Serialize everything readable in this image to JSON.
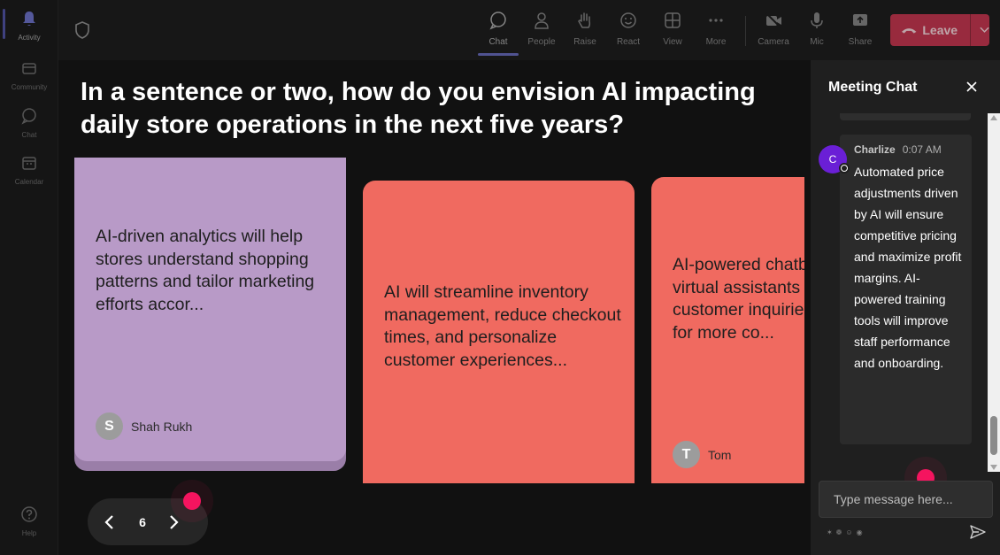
{
  "rail": [
    {
      "label": "Activity",
      "icon": "bell-icon"
    },
    {
      "label": "Community",
      "icon": "community-icon"
    },
    {
      "label": "Chat",
      "icon": "chat-icon"
    },
    {
      "label": "Calendar",
      "icon": "calendar-icon"
    },
    {
      "label": "Help",
      "icon": "help-icon"
    }
  ],
  "toolbar": {
    "chat": "Chat",
    "people": "People",
    "raise": "Raise",
    "react": "React",
    "view": "View",
    "more": "More",
    "camera": "Camera",
    "mic": "Mic",
    "share": "Share",
    "leave": "Leave"
  },
  "question": "In a sentence or two, how do you envision AI impacting daily store operations in the next five years?",
  "cards": [
    {
      "text": "AI-driven analytics will help stores understand shopping patterns and tailor marketing efforts accor...",
      "author": "Shah Rukh",
      "initial": "S",
      "color": "#b89ac7"
    },
    {
      "text": "AI will streamline inventory management, reduce checkout times, and personalize customer experiences...",
      "author": "",
      "initial": "",
      "color": "#f06a60"
    },
    {
      "text": "AI-powered chatbots and virtual assistants customer inquiries staff for more co...",
      "author": "Tom",
      "initial": "T",
      "color": "#f06a60"
    }
  ],
  "pager": {
    "page": "6"
  },
  "chat": {
    "title": "Meeting Chat",
    "message": {
      "sender": "Charlize",
      "initial": "C",
      "time": "0:07 AM",
      "text": "Automated price adjustments driven by AI will ensure competitive pricing and maximize profit margins. AI-powered training tools will improve staff performance and onboarding."
    },
    "input_placeholder": "Type message here..."
  },
  "colors": {
    "leave": "#c4314b",
    "accent": "#7f85f5",
    "pink_dot": "#f5145f",
    "chat_avatar": "#6a1fd6"
  }
}
